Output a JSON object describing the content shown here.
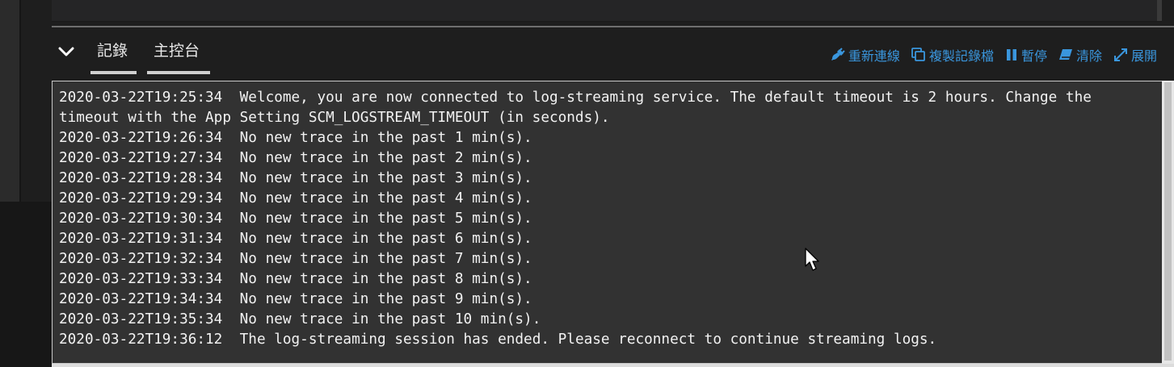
{
  "panel": {
    "tabs": [
      {
        "label": "記錄"
      },
      {
        "label": "主控台"
      }
    ],
    "actions": [
      {
        "label": "重新連線",
        "icon": "plug-icon"
      },
      {
        "label": "複製記錄檔",
        "icon": "copy-icon"
      },
      {
        "label": "暫停",
        "icon": "pause-icon"
      },
      {
        "label": "清除",
        "icon": "eraser-icon"
      },
      {
        "label": "展開",
        "icon": "expand-icon"
      }
    ]
  },
  "log": {
    "lines": [
      {
        "ts": "2020-03-22T19:25:34",
        "msg": "Welcome, you are now connected to log-streaming service. The default timeout is 2 hours. Change the timeout with the App Setting SCM_LOGSTREAM_TIMEOUT (in seconds)."
      },
      {
        "ts": "2020-03-22T19:26:34",
        "msg": "No new trace in the past 1 min(s)."
      },
      {
        "ts": "2020-03-22T19:27:34",
        "msg": "No new trace in the past 2 min(s)."
      },
      {
        "ts": "2020-03-22T19:28:34",
        "msg": "No new trace in the past 3 min(s)."
      },
      {
        "ts": "2020-03-22T19:29:34",
        "msg": "No new trace in the past 4 min(s)."
      },
      {
        "ts": "2020-03-22T19:30:34",
        "msg": "No new trace in the past 5 min(s)."
      },
      {
        "ts": "2020-03-22T19:31:34",
        "msg": "No new trace in the past 6 min(s)."
      },
      {
        "ts": "2020-03-22T19:32:34",
        "msg": "No new trace in the past 7 min(s)."
      },
      {
        "ts": "2020-03-22T19:33:34",
        "msg": "No new trace in the past 8 min(s)."
      },
      {
        "ts": "2020-03-22T19:34:34",
        "msg": "No new trace in the past 9 min(s)."
      },
      {
        "ts": "2020-03-22T19:35:34",
        "msg": "No new trace in the past 10 min(s)."
      },
      {
        "ts": "2020-03-22T19:36:12",
        "msg": "The log-streaming session has ended. Please reconnect to continue streaming logs."
      }
    ]
  },
  "colors": {
    "accent": "#3a96dd",
    "log_background": "#323232",
    "log_text": "#f2f2f2"
  }
}
